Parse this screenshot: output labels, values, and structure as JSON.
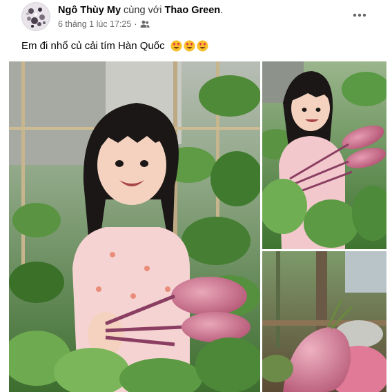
{
  "post": {
    "author": "Ngô Thùy My",
    "with_text": " cùng với ",
    "tagged": "Thao Green",
    "tagged_suffix": ".",
    "timestamp": "6 tháng 1 lúc 17:25",
    "separator": "·",
    "audience_icon": "friends-icon",
    "more_icon": "more-horizontal-icon",
    "caption": "Em đi nhổ củ cải tím Hàn Quốc",
    "caption_emojis": [
      "heart-eyes-emoji",
      "heart-eyes-emoji",
      "heart-eyes-emoji"
    ]
  },
  "photos": [
    {
      "name": "photo-girl-holding-radishes",
      "subject": "girl holding purple radishes in garden"
    },
    {
      "name": "photo-girl-with-radish-bunch",
      "subject": "girl holding bunch of purple radishes"
    },
    {
      "name": "photo-radishes-on-ground",
      "subject": "purple radishes on the ground"
    }
  ],
  "colors": {
    "text_primary": "#050505",
    "text_secondary": "#65676b",
    "leaf_green": "#4f8a3a",
    "radish_purple": "#c96a8a",
    "shirt_pink": "#f6d3d3"
  }
}
